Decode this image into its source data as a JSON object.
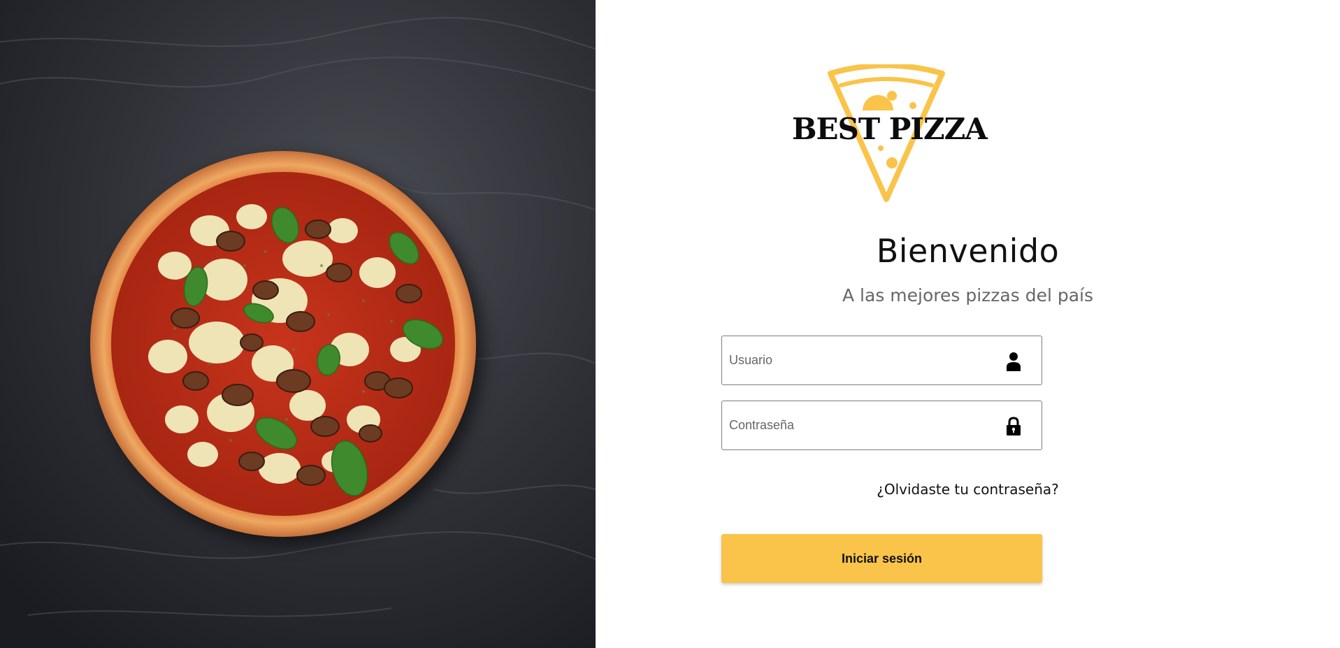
{
  "brand": {
    "name": "BEST PIZZA",
    "accent_color": "#f9c449"
  },
  "hero": {
    "image": "pizza-on-slate"
  },
  "login": {
    "title": "Bienvenido",
    "subtitle": "A las mejores pizzas del país",
    "username": {
      "placeholder": "Usuario",
      "value": "",
      "icon": "user-icon"
    },
    "password": {
      "placeholder": "Contraseña",
      "value": "",
      "icon": "lock-icon"
    },
    "forgot_link": "¿Olvidaste tu contraseña?",
    "submit_label": "Iniciar sesión"
  }
}
